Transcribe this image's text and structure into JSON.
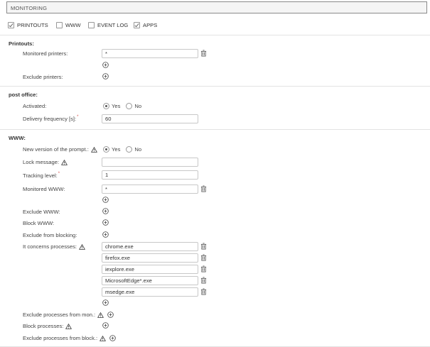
{
  "header": {
    "title": "MONITORING"
  },
  "tabs": [
    {
      "label": "PRINTOUTS",
      "checked": true
    },
    {
      "label": "WWW",
      "checked": false
    },
    {
      "label": "EVENT LOG",
      "checked": false
    },
    {
      "label": "APPS",
      "checked": true
    }
  ],
  "printouts": {
    "title": "Printouts:",
    "monitored_label": "Monitored printers:",
    "monitored_value": "*",
    "exclude_label": "Exclude printers:"
  },
  "post_office": {
    "title": "post office:",
    "activated_label": "Activated:",
    "yes": "Yes",
    "no": "No",
    "activated": "Yes",
    "frequency_label": "Delivery frequency [s]:",
    "frequency_value": "60"
  },
  "www": {
    "title": "WWW:",
    "new_version_label": "New version of the prompt.:",
    "yes": "Yes",
    "no": "No",
    "new_version": "Yes",
    "lock_message_label": "Lock message:",
    "lock_message_value": "",
    "tracking_label": "Tracking level:",
    "tracking_value": "1",
    "monitored_label": "Monitored WWW:",
    "monitored_value": "*",
    "exclude_label": "Exclude WWW:",
    "block_label": "Block WWW:",
    "exclude_blocking_label": "Exclude from blocking:",
    "processes_label": "It concerns processes:",
    "processes": [
      "chrome.exe",
      "firefox.exe",
      "iexplore.exe",
      "MicrosoftEdge*.exe",
      "msedge.exe"
    ],
    "exclude_processes_label": "Exclude processes from mon.:",
    "block_processes_label": "Block processes:",
    "exclude_block_processes_label": "Exclude processes from block.:"
  },
  "colors": {
    "border": "#8a8a8a",
    "required": "#d9534f",
    "divider": "#e3e3e3"
  }
}
